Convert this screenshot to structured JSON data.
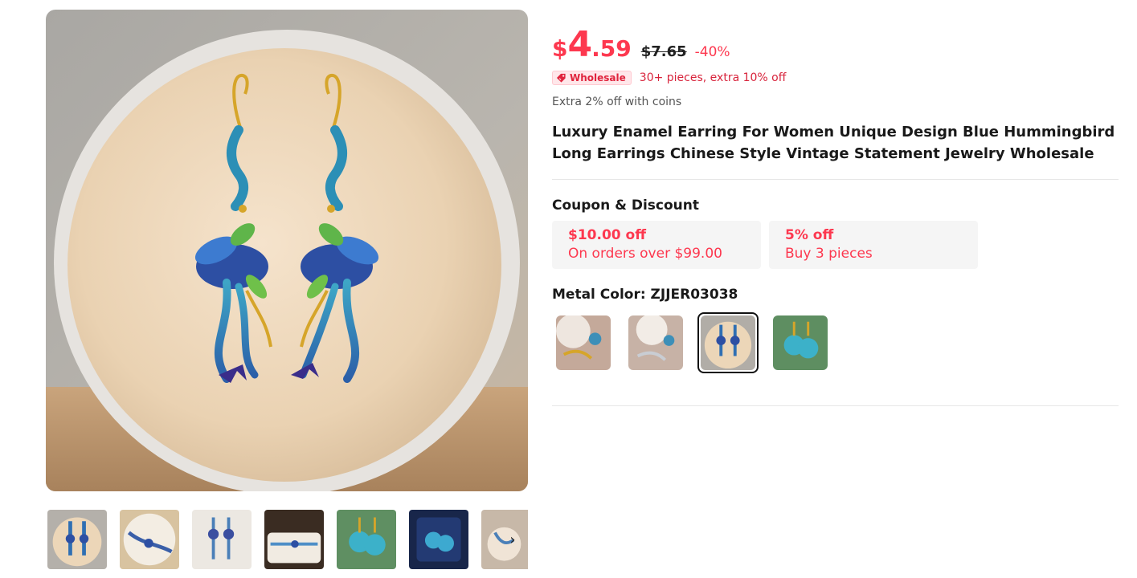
{
  "gallery": {
    "main_image": "earrings-photo",
    "thumbnails": [
      {
        "name": "thumb-1",
        "selected": true
      },
      {
        "name": "thumb-2",
        "selected": false
      },
      {
        "name": "thumb-3",
        "selected": false
      },
      {
        "name": "thumb-4",
        "selected": false
      },
      {
        "name": "thumb-5",
        "selected": false
      },
      {
        "name": "thumb-6",
        "selected": false
      },
      {
        "name": "thumb-7",
        "selected": false
      }
    ],
    "next_icon": "chevron-right-icon"
  },
  "price": {
    "currency": "$",
    "integer": "4",
    "decimal": ".59",
    "original": "$7.65",
    "discount": "-40%"
  },
  "wholesale": {
    "badge_label": "Wholesale",
    "badge_icon": "tag-icon",
    "text": "30+ pieces, extra 10% off"
  },
  "coins_text": "Extra 2% off with coins",
  "product_title": "Luxury Enamel Earring For Women Unique Design Blue Hummingbird Long Earrings Chinese Style Vintage Statement Jewelry Wholesale",
  "coupons": {
    "heading": "Coupon & Discount",
    "items": [
      {
        "value": "$10.00 off",
        "condition": "On orders over $99.00"
      },
      {
        "value": "5% off",
        "condition": "Buy 3 pieces"
      }
    ]
  },
  "metal_color": {
    "heading": "Metal Color: ZJJER03038",
    "selected_index": 2,
    "options_count": 4
  },
  "colors": {
    "accent": "#fd384f",
    "wholesale_badge_bg": "#ffe7ea",
    "coupon_bg": "#f5f5f5"
  }
}
